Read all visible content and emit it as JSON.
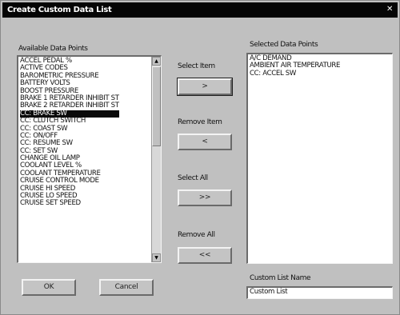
{
  "window": {
    "title": "Create Custom Data List",
    "close_glyph": "✕"
  },
  "available": {
    "label": "Available Data Points",
    "items": [
      "ACCEL PEDAL %",
      "ACTIVE CODES",
      "BAROMETRIC PRESSURE",
      "BATTERY VOLTS",
      "BOOST PRESSURE",
      "BRAKE 1 RETARDER INHIBIT ST",
      "BRAKE 2 RETARDER INHIBIT ST",
      "CC: BRAKE SW",
      "CC: CLUTCH SWITCH",
      "CC: COAST SW",
      "CC: ON/OFF",
      "CC: RESUME SW",
      "CC: SET SW",
      "CHANGE OIL LAMP",
      "COOLANT LEVEL %",
      "COOLANT TEMPERATURE",
      "CRUISE CONTROL MODE",
      "CRUISE HI SPEED",
      "CRUISE LO SPEED",
      "CRUISE SET SPEED"
    ],
    "selected_index": 7
  },
  "selected": {
    "label": "Selected Data Points",
    "items": [
      "A/C DEMAND",
      "AMBIENT AIR TEMPERATURE",
      "CC: ACCEL SW"
    ]
  },
  "actions": {
    "select_item_label": "Select Item",
    "select_item_button": ">",
    "remove_item_label": "Remove Item",
    "remove_item_button": "<",
    "select_all_label": "Select All",
    "select_all_button": ">>",
    "remove_all_label": "Remove All",
    "remove_all_button": "<<"
  },
  "custom_name": {
    "label": "Custom List Name",
    "value": "Custom List"
  },
  "footer": {
    "ok_label": "OK",
    "cancel_label": "Cancel"
  },
  "scroll": {
    "up_glyph": "▲",
    "down_glyph": "▼"
  }
}
